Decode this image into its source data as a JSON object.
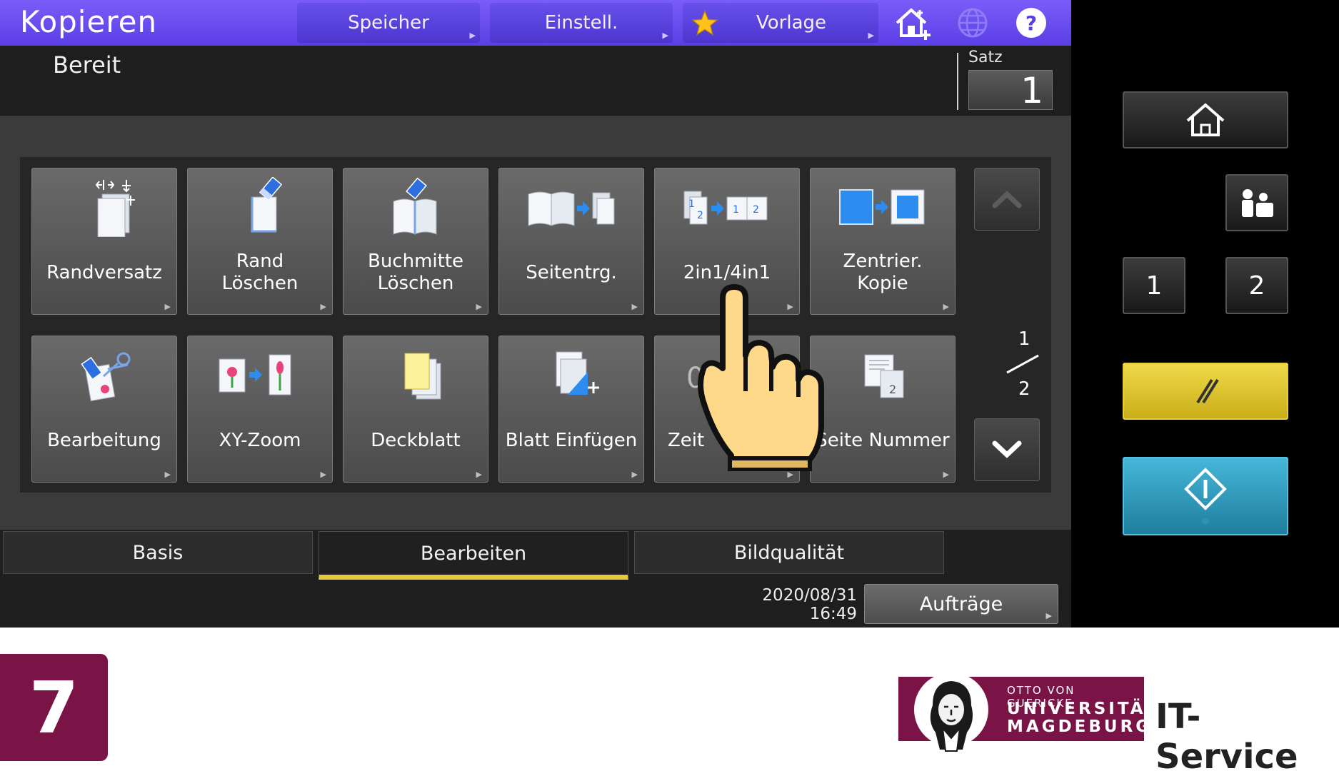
{
  "header": {
    "title": "Kopieren",
    "buttons": [
      {
        "id": "speicher",
        "label": "Speicher"
      },
      {
        "id": "einstell",
        "label": "Einstell."
      },
      {
        "id": "vorlage",
        "label": "Vorlage"
      }
    ],
    "icons": [
      "star-icon",
      "home-plus-icon",
      "globe-icon",
      "help-icon"
    ]
  },
  "status": {
    "text": "Bereit",
    "satz_label": "Satz",
    "satz_value": "1"
  },
  "tiles": [
    {
      "label": "Randversatz",
      "icon": "margin-shift-icon"
    },
    {
      "label": "Rand\nLöschen",
      "icon": "edge-erase-icon"
    },
    {
      "label": "Buchmitte\nLöschen",
      "icon": "book-center-erase-icon"
    },
    {
      "label": "Seitentrg.",
      "icon": "page-split-icon"
    },
    {
      "label": "2in1/4in1",
      "icon": "2in1-icon"
    },
    {
      "label": "Zentrier.\nKopie",
      "icon": "center-copy-icon"
    },
    {
      "label": "Bearbeitung",
      "icon": "edit-icon"
    },
    {
      "label": "XY-Zoom",
      "icon": "xy-zoom-icon"
    },
    {
      "label": "Deckblatt",
      "icon": "cover-sheet-icon"
    },
    {
      "label": "Blatt Einfügen",
      "icon": "insert-sheet-icon"
    },
    {
      "label": "Zeit",
      "icon": "time-stamp-icon"
    },
    {
      "label": "Seite Nummer",
      "icon": "page-number-icon"
    }
  ],
  "pager": {
    "current": "1",
    "total": "2"
  },
  "tabs": [
    {
      "label": "Basis",
      "active": false
    },
    {
      "label": "Bearbeiten",
      "active": true
    },
    {
      "label": "Bildqualität",
      "active": false
    }
  ],
  "footer": {
    "date": "2020/08/31",
    "time": "16:49",
    "jobs_label": "Aufträge"
  },
  "hardware": {
    "buttons": [
      {
        "id": "home",
        "icon": "home-icon"
      },
      {
        "id": "user",
        "icon": "user-icon"
      },
      {
        "id": "one",
        "label": "1"
      },
      {
        "id": "two",
        "label": "2"
      },
      {
        "id": "reset",
        "icon": "reset-icon",
        "color": "#e0c72f"
      },
      {
        "id": "start",
        "icon": "start-icon",
        "color": "#2f9dbe"
      }
    ]
  },
  "overlay": {
    "step": "7",
    "logo_line1": "OTTO VON GUERICKE",
    "logo_line2": "UNIVERSITÄT",
    "logo_line3": "MAGDEBURG",
    "brand": "IT-Service"
  },
  "colors": {
    "header": "#6a4ef0",
    "tab_active": "#e8c63c",
    "brand": "#7b1446",
    "reset": "#e0c72f",
    "start": "#2f9dbe"
  }
}
